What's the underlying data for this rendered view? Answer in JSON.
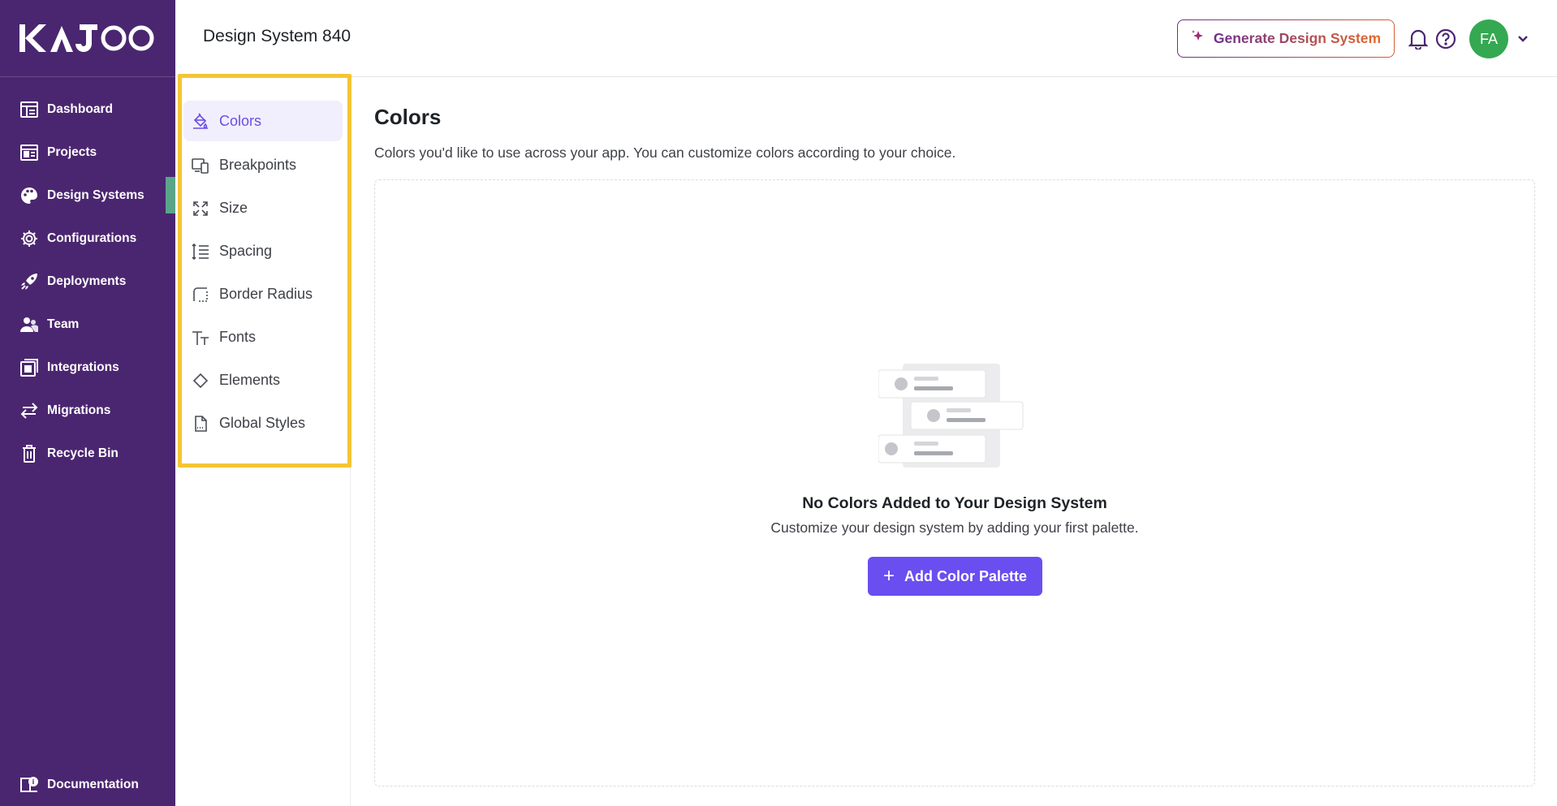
{
  "brand": {
    "logo_text": "KAJOO"
  },
  "sidebar": {
    "items": [
      {
        "label": "Dashboard",
        "icon": "dashboard-icon"
      },
      {
        "label": "Projects",
        "icon": "projects-icon"
      },
      {
        "label": "Design Systems",
        "icon": "palette-icon",
        "active": true
      },
      {
        "label": "Configurations",
        "icon": "gear-icon"
      },
      {
        "label": "Deployments",
        "icon": "rocket-icon"
      },
      {
        "label": "Team",
        "icon": "team-icon"
      },
      {
        "label": "Integrations",
        "icon": "integrations-icon"
      },
      {
        "label": "Migrations",
        "icon": "arrows-exchange-icon"
      },
      {
        "label": "Recycle Bin",
        "icon": "trash-icon"
      }
    ],
    "footer": {
      "label": "Documentation",
      "icon": "documentation-icon"
    }
  },
  "header": {
    "title": "Design System 840",
    "generate_label": "Generate Design System",
    "avatar_initials": "FA"
  },
  "subnav": {
    "items": [
      {
        "label": "Colors",
        "icon": "paint-bucket-icon",
        "active": true
      },
      {
        "label": "Breakpoints",
        "icon": "devices-icon"
      },
      {
        "label": "Size",
        "icon": "expand-icon"
      },
      {
        "label": "Spacing",
        "icon": "line-height-icon"
      },
      {
        "label": "Border Radius",
        "icon": "border-radius-icon"
      },
      {
        "label": "Fonts",
        "icon": "text-size-icon"
      },
      {
        "label": "Elements",
        "icon": "diamond-icon"
      },
      {
        "label": "Global Styles",
        "icon": "file-css-icon"
      }
    ]
  },
  "main": {
    "title": "Colors",
    "description": "Colors you'd like to use across your app. You can customize colors according to your choice.",
    "empty_title": "No Colors Added to Your Design System",
    "empty_subtitle": "Customize your design system by adding your first palette.",
    "add_button_label": "Add Color Palette"
  },
  "colors": {
    "sidebar_bg": "#4b2670",
    "accent": "#6a4ef0",
    "highlight": "#f4c534",
    "avatar": "#35a852"
  }
}
